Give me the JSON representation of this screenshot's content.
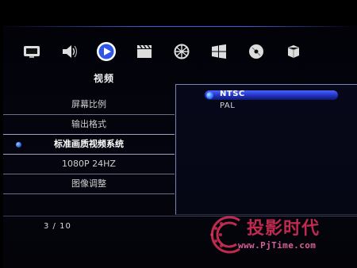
{
  "icons": [
    {
      "name": "tv-icon"
    },
    {
      "name": "speaker-icon"
    },
    {
      "name": "play-video-icon",
      "selected": true
    },
    {
      "name": "clapperboard-icon"
    },
    {
      "name": "network-globe-icon"
    },
    {
      "name": "windows-icon"
    },
    {
      "name": "disc-icon"
    },
    {
      "name": "box-icon"
    }
  ],
  "section_title": "视频",
  "menu": {
    "items": [
      {
        "label": "屏幕比例",
        "selected": false
      },
      {
        "label": "输出格式",
        "selected": false
      },
      {
        "label": "标准画质视频系统",
        "selected": true
      },
      {
        "label": "1080P 24HZ",
        "selected": false
      },
      {
        "label": "图像调整",
        "selected": false
      }
    ]
  },
  "options": {
    "items": [
      {
        "label": "NTSC",
        "selected": true
      },
      {
        "label": "PAL",
        "selected": false
      }
    ]
  },
  "pager": {
    "text": "3 / 10"
  },
  "watermark": {
    "text": "投影时代",
    "url": "www.PjTime.com"
  },
  "colors": {
    "accent": "#2f56e8",
    "watermark": "#e0325a"
  }
}
